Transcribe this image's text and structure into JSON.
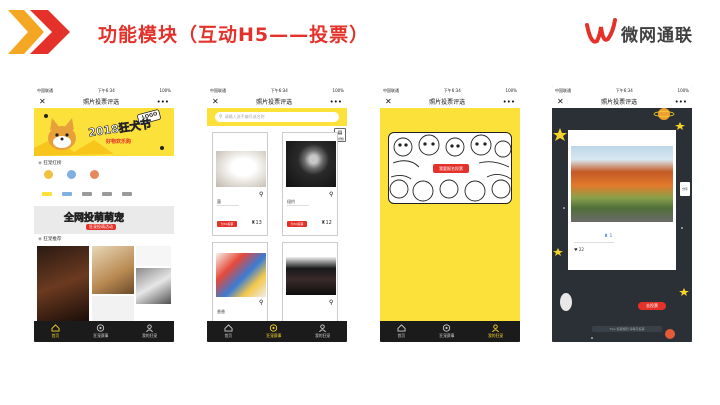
{
  "header": {
    "title": "功能模块（互动H5——投票）",
    "logo_text": "微网通联",
    "accent": "#e4322b",
    "chevron_colors": [
      "#f5a623",
      "#e4322b"
    ]
  },
  "common": {
    "carrier": "中国联通",
    "time": "下午6:34",
    "battery": "100%",
    "page_title": "照片投票评选",
    "close_icon": "close-icon",
    "more_icon": "more-dots-icon"
  },
  "phone1": {
    "banner_text": "2018狂犬节",
    "banner_sub": "好物欢乐购",
    "logo_badge": "LOGO",
    "section_hot": "狂宠红榜",
    "section_new": "狂宠推荐",
    "promo_title": "全网投萌萌宠",
    "promo_sub": "狂宠投萌活动",
    "tabs": [
      "首页",
      "狂宠赛事",
      "我的狂宠"
    ],
    "active_tab": 0
  },
  "phone2": {
    "search_placeholder": "请输入选手编号或名称",
    "rank_label": "排行榜",
    "cards": [
      {
        "name": "菌",
        "votes": "13",
        "vote_btn": "为TA投票"
      },
      {
        "name": "纽约",
        "votes": "12",
        "vote_btn": "为TA投票"
      },
      {
        "name": "香香",
        "votes": "",
        "vote_btn": ""
      },
      {
        "name": "",
        "votes": "",
        "vote_btn": ""
      }
    ],
    "tabs": [
      "首页",
      "狂宠赛事",
      "我的狂宠"
    ],
    "active_tab": 1
  },
  "phone3": {
    "button_label": "我要报名投票",
    "tabs": [
      "首页",
      "狂宠赛事",
      "我的狂宠"
    ],
    "active_tab": 2
  },
  "phone4": {
    "rank": "1",
    "votes": "22",
    "vote_btn": "去投票",
    "side_label": "分享",
    "footer_note": "Tips 投票规则 请每天投票"
  }
}
